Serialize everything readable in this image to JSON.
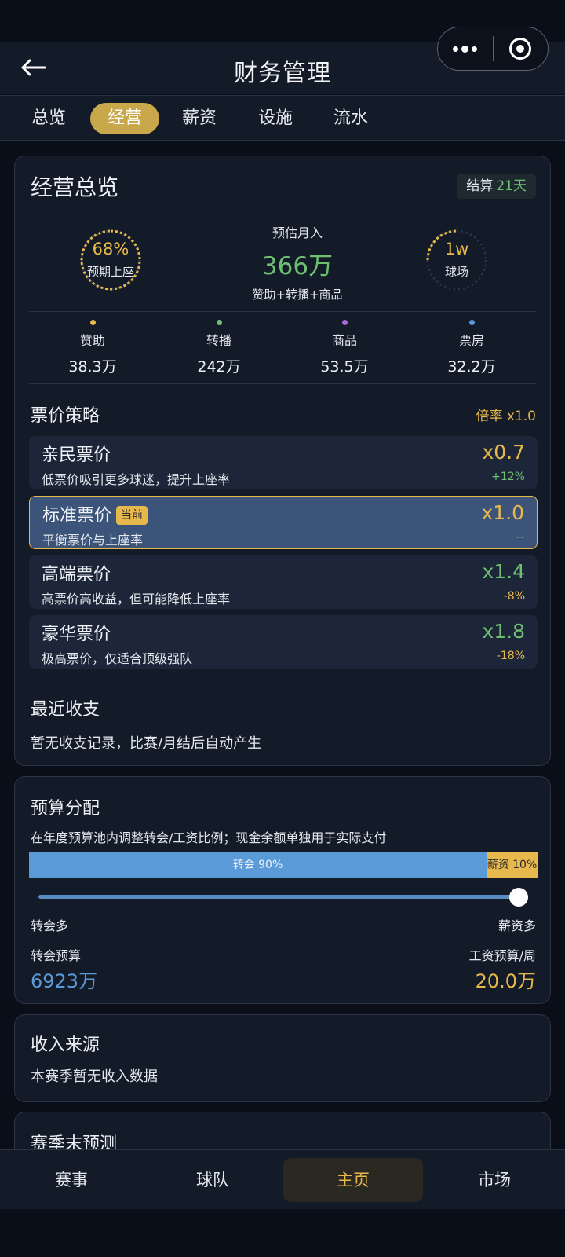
{
  "header": {
    "title": "财务管理"
  },
  "tabs": [
    "总览",
    "经营",
    "薪资",
    "设施",
    "流水"
  ],
  "overview": {
    "title": "经营总览",
    "settle_label": "结算",
    "settle_days": "21天",
    "attendance_value": "68%",
    "attendance_fraction": 0.68,
    "attendance_label": "预期上座",
    "income_label": "预估月入",
    "income_value": "366万",
    "income_sub": "赞助+转播+商品",
    "stadium_value": "1w",
    "stadium_label": "球场",
    "sources": [
      {
        "name": "赞助",
        "value": "38.3万",
        "color": "#e7b94c"
      },
      {
        "name": "转播",
        "value": "242万",
        "color": "#6fbf73"
      },
      {
        "name": "商品",
        "value": "53.5万",
        "color": "#a86ad8"
      },
      {
        "name": "票房",
        "value": "32.2万",
        "color": "#5b9ad8"
      }
    ]
  },
  "ticket": {
    "title": "票价策略",
    "multiplier_label": "倍率 x1.0",
    "current_badge": "当前",
    "options": [
      {
        "name": "亲民票价",
        "desc": "低票价吸引更多球迷，提升上座率",
        "mult": "x0.7",
        "delta": "+12%",
        "mult_color": "#e7b94c",
        "delta_color": "#6fbf73"
      },
      {
        "name": "标准票价",
        "desc": "平衡票价与上座率",
        "mult": "x1.0",
        "delta": "--",
        "mult_color": "#e7b94c",
        "delta_color": "#6fbf73"
      },
      {
        "name": "高端票价",
        "desc": "高票价高收益，但可能降低上座率",
        "mult": "x1.4",
        "delta": "-8%",
        "mult_color": "#6fbf73",
        "delta_color": "#e7b94c"
      },
      {
        "name": "豪华票价",
        "desc": "极高票价，仅适合顶级强队",
        "mult": "x1.8",
        "delta": "-18%",
        "mult_color": "#6fbf73",
        "delta_color": "#e7b94c"
      }
    ]
  },
  "recent": {
    "title": "最近收支",
    "empty": "暂无收支记录，比赛/月结后自动产生"
  },
  "budget": {
    "title": "预算分配",
    "desc": "在年度预算池内调整转会/工资比例；现金余额单独用于实际支付",
    "transfer_bar_label": "转会 90%",
    "salary_bar_label": "薪资 10%",
    "transfer_fraction": 0.9,
    "slider_left": "转会多",
    "slider_right": "薪资多",
    "transfer_label": "转会预算",
    "transfer_value": "6923万",
    "salary_label": "工资预算/周",
    "salary_value": "20.0万"
  },
  "income_sources": {
    "title": "收入来源",
    "empty": "本赛季暂无收入数据"
  },
  "forecast": {
    "title": "赛季末预测"
  },
  "nav": [
    "赛事",
    "球队",
    "主页",
    "市场"
  ]
}
